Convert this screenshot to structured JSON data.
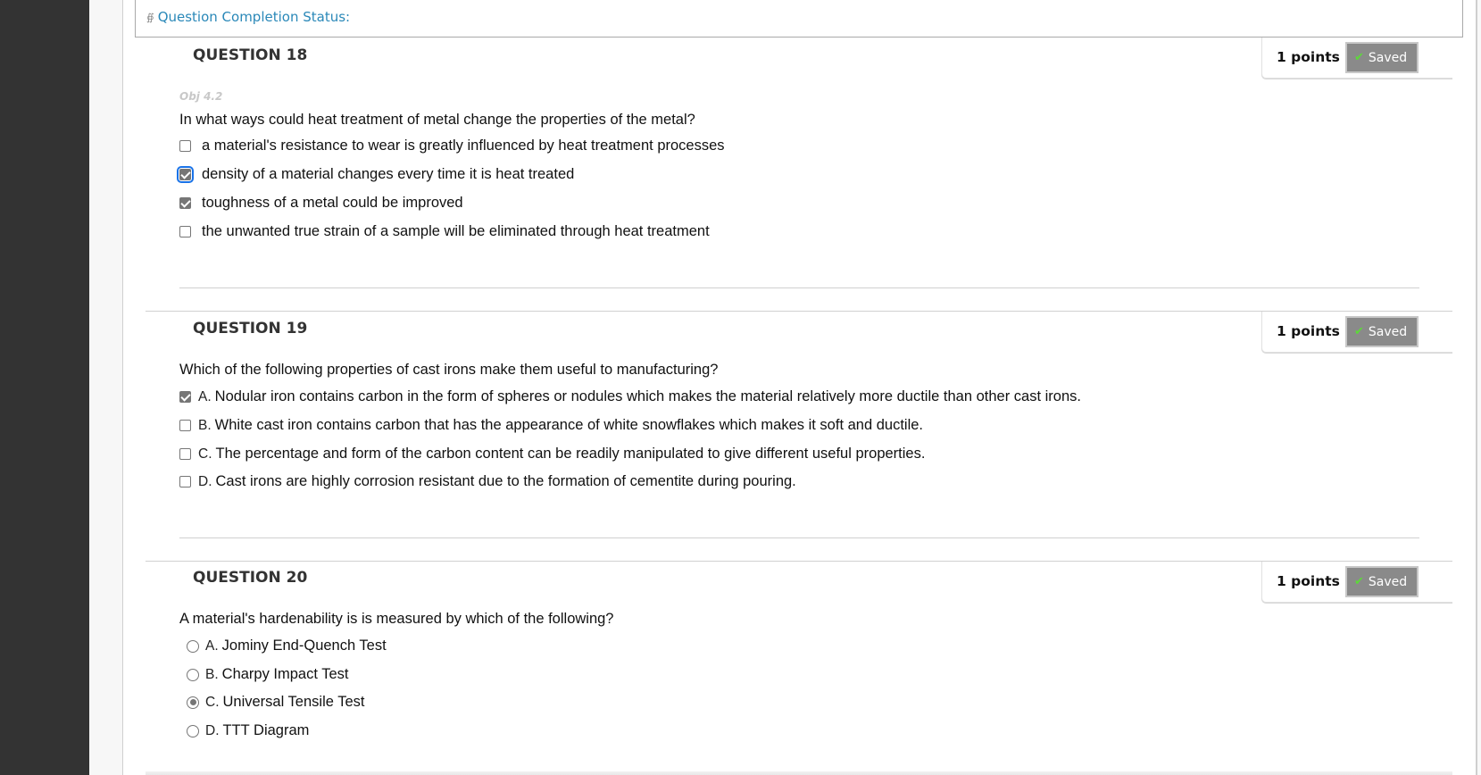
{
  "status": {
    "label": "Question Completion Status:",
    "icon": "double-chevron-down-icon"
  },
  "questions": [
    {
      "title": "QUESTION 18",
      "points": "1 points",
      "saved_label": "Saved",
      "objective": "Obj 4.2",
      "text": "In what ways could heat treatment of metal change the properties of the metal?",
      "type": "checkbox",
      "options": [
        {
          "letter": "",
          "text": "a material's resistance to wear is greatly influenced by heat treatment processes",
          "checked": false
        },
        {
          "letter": "",
          "text": "density of a material changes every time it is heat treated",
          "checked": true,
          "focused": true
        },
        {
          "letter": "",
          "text": "toughness of a metal could be improved",
          "checked": true
        },
        {
          "letter": "",
          "text": "the unwanted true strain of a sample will be eliminated through heat treatment",
          "checked": false
        }
      ]
    },
    {
      "title": "QUESTION 19",
      "points": "1 points",
      "saved_label": "Saved",
      "text": "Which of the following properties of cast irons make them useful to manufacturing?",
      "type": "checkbox",
      "options": [
        {
          "letter": "A.",
          "text": "Nodular iron contains carbon in the form of spheres or nodules which makes the material relatively more ductile than other cast irons.",
          "checked": true
        },
        {
          "letter": "B.",
          "text": "White cast iron contains carbon that has the appearance of white snowflakes which makes it soft and ductile.",
          "checked": false
        },
        {
          "letter": "C.",
          "text": "The percentage and form of the carbon content can be readily manipulated to give different useful properties.",
          "checked": false
        },
        {
          "letter": "D.",
          "text": "Cast irons are highly corrosion resistant due to the formation of cementite during pouring.",
          "checked": false
        }
      ]
    },
    {
      "title": "QUESTION 20",
      "points": "1 points",
      "saved_label": "Saved",
      "text": "A material's hardenability is is measured by which of the following?",
      "type": "radio",
      "options": [
        {
          "letter": "A.",
          "text": "Jominy End-Quench Test",
          "checked": false
        },
        {
          "letter": "B.",
          "text": "Charpy Impact Test",
          "checked": false
        },
        {
          "letter": "C.",
          "text": "Universal Tensile Test",
          "checked": true
        },
        {
          "letter": "D.",
          "text": "TTT Diagram",
          "checked": false
        }
      ]
    }
  ],
  "colors": {
    "link": "#2a88b8",
    "saved_bg": "#8a8a8a",
    "check_green": "#5dd83a",
    "sidebar": "#333333"
  }
}
